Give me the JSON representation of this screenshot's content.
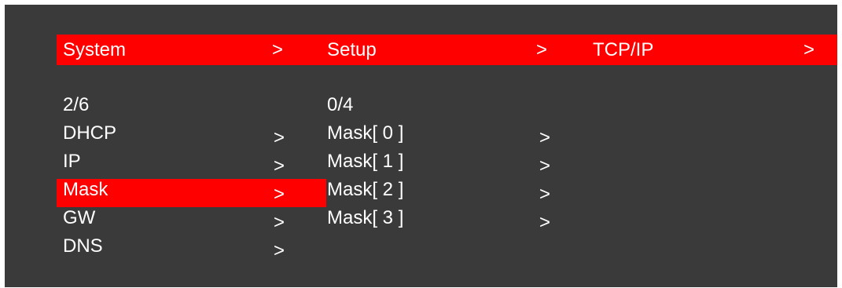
{
  "header": {
    "crumbs": [
      {
        "label": "System",
        "arrow": ">"
      },
      {
        "label": "Setup",
        "arrow": ">"
      },
      {
        "label": "TCP/IP",
        "arrow": ">"
      }
    ]
  },
  "left_menu": {
    "position": "2/6",
    "items": [
      {
        "label": "DHCP",
        "arrow": ">"
      },
      {
        "label": "IP",
        "arrow": ">"
      },
      {
        "label": "Mask",
        "arrow": ">",
        "selected": true
      },
      {
        "label": "GW",
        "arrow": ">"
      },
      {
        "label": "DNS",
        "arrow": ">"
      }
    ]
  },
  "mid_menu": {
    "position": "0/4",
    "items": [
      {
        "label": "Mask[ 0 ]",
        "arrow": ">"
      },
      {
        "label": "Mask[ 1 ]",
        "arrow": ">"
      },
      {
        "label": "Mask[ 2 ]",
        "arrow": ">"
      },
      {
        "label": "Mask[ 3 ]",
        "arrow": ">"
      }
    ]
  },
  "colors": {
    "background": "#3a3a3a",
    "highlight": "#ff0000",
    "text": "#ffffff"
  }
}
